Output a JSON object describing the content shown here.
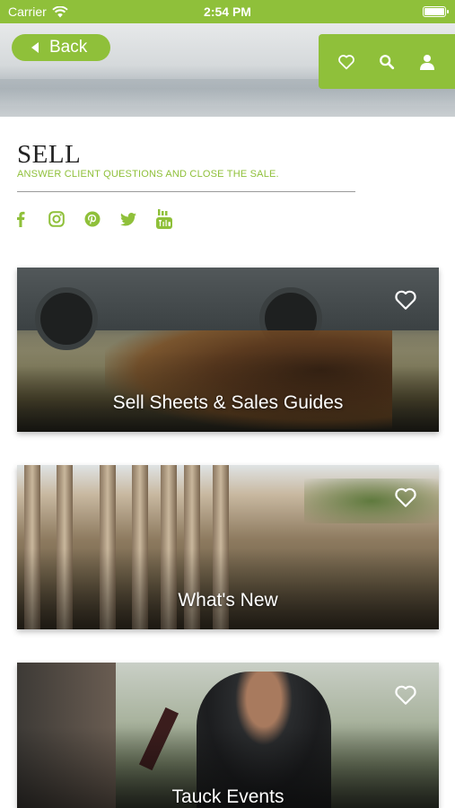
{
  "status_bar": {
    "carrier": "Carrier",
    "time": "2:54 PM"
  },
  "nav": {
    "back_label": "Back"
  },
  "actions": {
    "icons": [
      "heart-icon",
      "search-icon",
      "user-icon"
    ]
  },
  "header": {
    "title": "SELL",
    "subtitle": "ANSWER CLIENT QUESTIONS AND CLOSE THE SALE."
  },
  "social": [
    "facebook-icon",
    "instagram-icon",
    "pinterest-icon",
    "twitter-icon",
    "youtube-icon"
  ],
  "cards": [
    {
      "label": "Sell Sheets & Sales Guides"
    },
    {
      "label": "What's New"
    },
    {
      "label": "Tauck Events"
    }
  ],
  "colors": {
    "accent": "#8fc03a",
    "title": "#222222",
    "card_label": "#ffffff"
  }
}
